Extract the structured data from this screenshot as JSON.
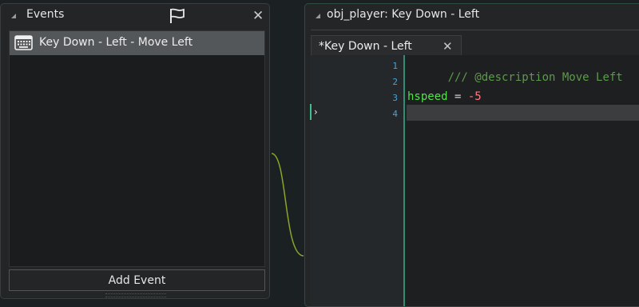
{
  "events_panel": {
    "title": "Events",
    "events": [
      {
        "label": "Key Down - Left - Move Left",
        "icon": "keyboard-icon"
      }
    ],
    "add_event_label": "Add Event"
  },
  "editor_panel": {
    "title": "obj_player: Key Down - Left",
    "tab_label": "*Key Down - Left",
    "line_numbers": [
      "1",
      "2",
      "3",
      "4"
    ],
    "code": {
      "line1": "/// @description Move Left",
      "line3_var": "hspeed",
      "line3_op": " = ",
      "line3_num": "-5"
    }
  },
  "colors": {
    "accent": "#3fbf8c",
    "line_number": "#49a3d6",
    "comment": "#5d9a4b",
    "variable": "#54e04c",
    "number": "#ff7a80"
  }
}
